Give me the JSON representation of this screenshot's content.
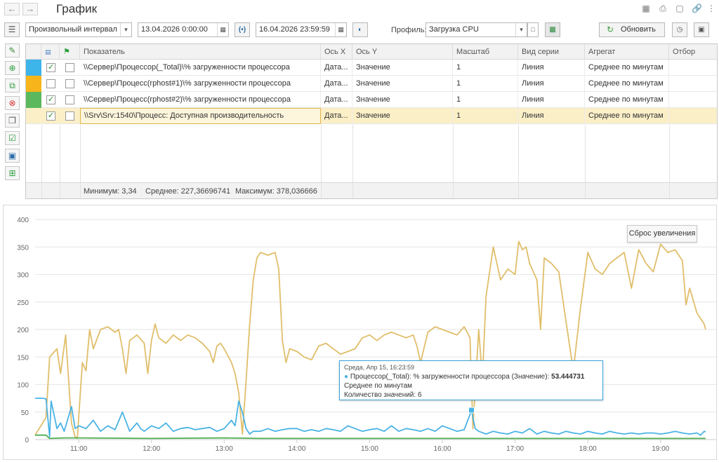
{
  "window": {
    "title": "График"
  },
  "toolbar": {
    "interval_mode": "Произвольный интервал",
    "date_from": "13.04.2026  0:00:00",
    "date_to": "16.04.2026 23:59:59",
    "profile_label": "Профиль:",
    "profile_value": "Загрузка CPU",
    "refresh_label": "Обновить"
  },
  "table": {
    "columns": [
      "Показатель",
      "Ось X",
      "Ось Y",
      "Масштаб",
      "Вид серии",
      "Агрегат",
      "Отбор"
    ],
    "rows": [
      {
        "color": "#3db4ea",
        "checked": true,
        "flag": false,
        "indicator": "\\\\Сервер\\Процессор(_Total)\\% загруженности процессора",
        "x_axis": "Дата...",
        "y_axis": "Значение",
        "scale": "1",
        "series_type": "Линия",
        "aggregate": "Среднее по минутам",
        "filter": ""
      },
      {
        "color": "#f7b51b",
        "checked": false,
        "flag": false,
        "indicator": "\\\\Сервер\\Процесс(rphost#1)\\% загруженности процессора",
        "x_axis": "Дата...",
        "y_axis": "Значение",
        "scale": "1",
        "series_type": "Линия",
        "aggregate": "Среднее по минутам",
        "filter": ""
      },
      {
        "color": "#5cb85c",
        "checked": true,
        "flag": false,
        "indicator": "\\\\Сервер\\Процесс(rphost#2)\\% загруженности процессора",
        "x_axis": "Дата...",
        "y_axis": "Значение",
        "scale": "1",
        "series_type": "Линия",
        "aggregate": "Среднее по минутам",
        "filter": ""
      },
      {
        "color": "",
        "checked": true,
        "flag": false,
        "indicator": "\\\\Srv\\Srv:1540\\Процесс: Доступная производительность",
        "x_axis": "Дата...",
        "y_axis": "Значение",
        "scale": "1",
        "series_type": "Линия",
        "aggregate": "Среднее по минутам",
        "filter": ""
      }
    ],
    "footer": {
      "min": "Минимум: 3,34",
      "avg": "Среднее: 227,36696741",
      "max": "Максимум: 378,036666"
    }
  },
  "chart": {
    "reset_zoom_label": "Сброс увеличения",
    "tooltip": {
      "time": "Среда, Апр 15, 16:23:59",
      "series": "Процессор(_Total): % загруженности процессора (Значение): ",
      "value": "53.444731",
      "aggregate": "Среднее по минутам",
      "count": "Количество значений: 6"
    }
  },
  "chart_data": {
    "type": "line",
    "yticks": [
      "0",
      "50",
      "100",
      "150",
      "200",
      "250",
      "300",
      "350",
      "400"
    ],
    "xticks": [
      "11:00",
      "12:00",
      "13:00",
      "14:00",
      "15:00",
      "16:00",
      "17:00",
      "18:00",
      "19:00"
    ],
    "ylim": [
      0,
      400
    ],
    "x_unit": "hours",
    "xlim": [
      10.4,
      19.62
    ],
    "series": [
      {
        "color": "#e0be6a",
        "x": [
          10.4,
          10.55,
          10.6,
          10.7,
          10.75,
          10.82,
          10.9,
          10.95,
          10.98,
          11.05,
          11.1,
          11.15,
          11.2,
          11.3,
          11.4,
          11.5,
          11.55,
          11.6,
          11.65,
          11.7,
          11.8,
          11.9,
          11.95,
          12.0,
          12.05,
          12.1,
          12.2,
          12.3,
          12.4,
          12.5,
          12.6,
          12.7,
          12.8,
          12.85,
          12.9,
          12.95,
          13.0,
          13.1,
          13.15,
          13.2,
          13.25,
          13.3,
          13.35,
          13.4,
          13.45,
          13.5,
          13.6,
          13.7,
          13.75,
          13.8,
          13.85,
          13.9,
          14.0,
          14.1,
          14.2,
          14.3,
          14.4,
          14.5,
          14.6,
          14.7,
          14.8,
          14.9,
          15.0,
          15.1,
          15.2,
          15.3,
          15.4,
          15.5,
          15.6,
          15.65,
          15.7,
          15.8,
          15.9,
          16.0,
          16.1,
          16.2,
          16.3,
          16.38,
          16.42,
          16.5,
          16.55,
          16.6,
          16.7,
          16.8,
          16.9,
          17.0,
          17.05,
          17.1,
          17.15,
          17.2,
          17.3,
          17.35,
          17.4,
          17.5,
          17.6,
          17.7,
          17.8,
          17.9,
          18.0,
          18.1,
          18.2,
          18.3,
          18.4,
          18.5,
          18.6,
          18.7,
          18.8,
          18.9,
          19.0,
          19.1,
          19.2,
          19.3,
          19.35,
          19.4,
          19.5,
          19.6,
          19.62
        ],
        "values": [
          8,
          40,
          150,
          165,
          120,
          190,
          30,
          5,
          2,
          140,
          125,
          200,
          165,
          200,
          205,
          195,
          200,
          165,
          120,
          180,
          190,
          175,
          120,
          180,
          210,
          185,
          175,
          190,
          180,
          190,
          185,
          175,
          160,
          140,
          170,
          175,
          165,
          140,
          120,
          85,
          10,
          105,
          210,
          290,
          330,
          340,
          335,
          340,
          310,
          180,
          140,
          165,
          160,
          150,
          145,
          170,
          175,
          165,
          155,
          160,
          165,
          185,
          190,
          180,
          190,
          195,
          190,
          185,
          190,
          170,
          140,
          195,
          205,
          200,
          195,
          190,
          205,
          185,
          20,
          200,
          110,
          260,
          350,
          290,
          310,
          300,
          360,
          345,
          350,
          320,
          290,
          200,
          330,
          320,
          305,
          215,
          125,
          240,
          340,
          310,
          300,
          320,
          330,
          340,
          275,
          345,
          320,
          305,
          355,
          340,
          345,
          325,
          245,
          275,
          230,
          210,
          200
        ],
        "note": ""
      },
      {
        "color": "#4ab3e4",
        "x": [
          10.4,
          10.45,
          10.5,
          10.55,
          10.6,
          10.62,
          10.7,
          10.75,
          10.8,
          10.9,
          10.95,
          11.0,
          11.1,
          11.2,
          11.3,
          11.4,
          11.5,
          11.6,
          11.7,
          11.8,
          11.85,
          11.9,
          12.0,
          12.1,
          12.2,
          12.3,
          12.4,
          12.5,
          12.6,
          12.7,
          12.8,
          12.9,
          13.0,
          13.1,
          13.15,
          13.2,
          13.25,
          13.3,
          13.35,
          13.4,
          13.5,
          13.6,
          13.7,
          13.8,
          13.9,
          14.0,
          14.1,
          14.2,
          14.3,
          14.4,
          14.5,
          14.6,
          14.7,
          14.8,
          14.9,
          15.0,
          15.1,
          15.2,
          15.3,
          15.4,
          15.5,
          15.6,
          15.7,
          15.8,
          15.9,
          16.0,
          16.1,
          16.2,
          16.3,
          16.4,
          16.45,
          16.5,
          16.6,
          16.7,
          16.8,
          16.9,
          17.0,
          17.1,
          17.2,
          17.3,
          17.4,
          17.5,
          17.6,
          17.7,
          17.8,
          17.9,
          18.0,
          18.1,
          18.2,
          18.3,
          18.4,
          18.5,
          18.6,
          18.7,
          18.8,
          18.9,
          19.0,
          19.1,
          19.2,
          19.3,
          19.4,
          19.5,
          19.55,
          19.6,
          19.62
        ],
        "values": [
          75,
          75,
          75,
          74,
          5,
          70,
          20,
          30,
          15,
          60,
          20,
          25,
          20,
          35,
          15,
          25,
          18,
          50,
          15,
          30,
          20,
          15,
          25,
          20,
          30,
          15,
          20,
          22,
          18,
          20,
          22,
          15,
          20,
          35,
          25,
          70,
          50,
          20,
          10,
          15,
          15,
          20,
          15,
          18,
          20,
          20,
          15,
          18,
          15,
          20,
          18,
          15,
          25,
          20,
          15,
          18,
          20,
          15,
          25,
          15,
          20,
          18,
          15,
          20,
          15,
          25,
          20,
          15,
          18,
          53,
          20,
          15,
          10,
          15,
          12,
          10,
          15,
          12,
          20,
          10,
          15,
          12,
          10,
          15,
          12,
          10,
          15,
          12,
          10,
          15,
          12,
          10,
          12,
          10,
          12,
          12,
          10,
          12,
          15,
          12,
          10,
          12,
          8,
          15,
          14
        ],
        "note": ""
      },
      {
        "color": "#4caf50",
        "x": [
          10.4,
          10.55,
          10.6,
          10.8,
          11.0,
          12.0,
          13.0,
          13.5,
          14.0,
          15.0,
          16.0,
          17.0,
          18.0,
          19.0,
          19.62
        ],
        "values": [
          8,
          8,
          2,
          3,
          3,
          2,
          3,
          2,
          2,
          2,
          2,
          2,
          2,
          2,
          2
        ],
        "note": ""
      }
    ]
  }
}
